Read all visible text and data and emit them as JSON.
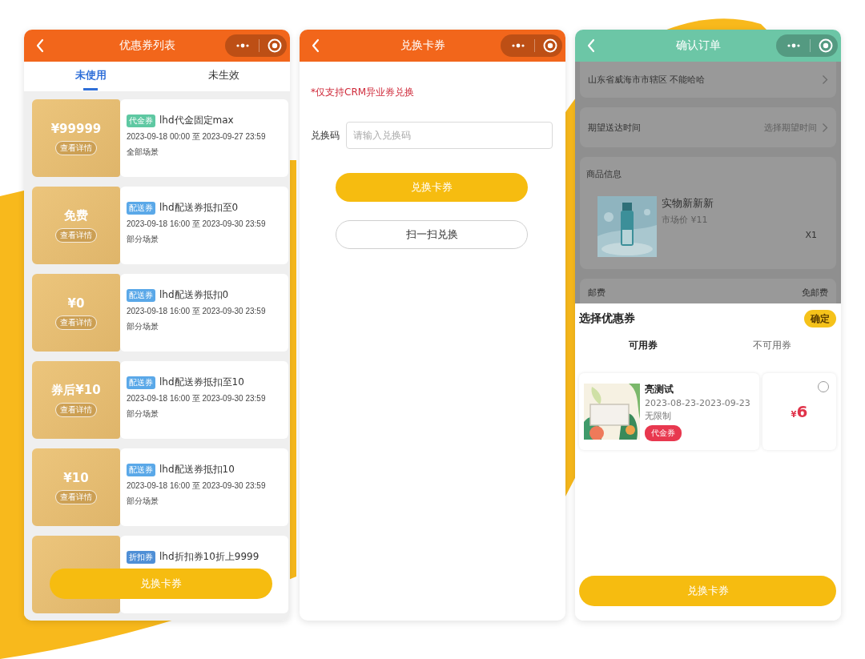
{
  "screens": [
    {
      "kind": "coupon_list",
      "header": {
        "title": "优惠券列表",
        "color": "#f2661b"
      },
      "tabs": [
        {
          "label": "未使用",
          "selected": true
        },
        {
          "label": "未生效",
          "selected": false
        }
      ],
      "coupons": [
        {
          "amount": "¥99999",
          "details": "查看详情",
          "tag": {
            "label": "代金券",
            "color": "#5ec8a2"
          },
          "name": "lhd代金固定max",
          "validity": "2023-09-18 00:00 至 2023-09-27 23:59",
          "scope": "全部场景"
        },
        {
          "amount": "免费",
          "details": "查看详情",
          "tag": {
            "label": "配送券",
            "color": "#5aa8e8"
          },
          "name": "lhd配送券抵扣至0",
          "validity": "2023-09-18 16:00 至 2023-09-30 23:59",
          "scope": "部分场景"
        },
        {
          "amount": "¥0",
          "details": "查看详情",
          "tag": {
            "label": "配送券",
            "color": "#5aa8e8"
          },
          "name": "lhd配送券抵扣0",
          "validity": "2023-09-18 16:00 至 2023-09-30 23:59",
          "scope": "部分场景"
        },
        {
          "amount": "券后¥10",
          "details": "查看详情",
          "tag": {
            "label": "配送券",
            "color": "#5aa8e8"
          },
          "name": "lhd配送券抵扣至10",
          "validity": "2023-09-18 16:00 至 2023-09-30 23:59",
          "scope": "部分场景"
        },
        {
          "amount": "¥10",
          "details": "查看详情",
          "tag": {
            "label": "配送券",
            "color": "#5aa8e8"
          },
          "name": "lhd配送券抵扣10",
          "validity": "2023-09-18 16:00 至 2023-09-30 23:59",
          "scope": "部分场景"
        },
        {
          "tag": {
            "label": "折扣券",
            "color": "#4f8fd6"
          },
          "name": "lhd折扣券10折上9999"
        }
      ],
      "action_button": "兑换卡券"
    },
    {
      "kind": "redeem",
      "header": {
        "title": "兑换卡券",
        "color": "#f2661b"
      },
      "notice": "*仅支持CRM异业券兑换",
      "code_field": {
        "label": "兑换码",
        "placeholder": "请输入兑换码"
      },
      "buttons": [
        {
          "label": "兑换卡券",
          "kind": "primary"
        },
        {
          "label": "扫一扫兑换",
          "kind": "outline"
        }
      ]
    },
    {
      "kind": "confirm_order",
      "header": {
        "title": "确认订单",
        "color": "#6cc6a6"
      },
      "address": "山东省威海市市辖区 不能哈哈",
      "delivery": {
        "label": "期望送达时间",
        "value": "选择期望时间"
      },
      "goods": {
        "heading": "商品信息",
        "items": [
          {
            "kind": "picture",
            "name": "实物新新新",
            "price": "市场价 ¥11",
            "quantity": "X1"
          }
        ]
      },
      "shipping": {
        "label": "邮费",
        "value": "免邮费"
      },
      "coupon_sheet": {
        "title": "选择优惠券",
        "confirm": "确定",
        "tabs": [
          {
            "label": "可用券",
            "selected": true
          },
          {
            "label": "不可用券",
            "selected": false
          }
        ],
        "coupons": [
          {
            "kind": "picture",
            "name": "亮测试",
            "validity": "2023-08-23-2023-09-23",
            "limit": "无限制",
            "tag": "代金券",
            "currency": "¥",
            "amount": "6",
            "selected": false
          }
        ]
      },
      "action_button": "兑换卡券"
    }
  ]
}
